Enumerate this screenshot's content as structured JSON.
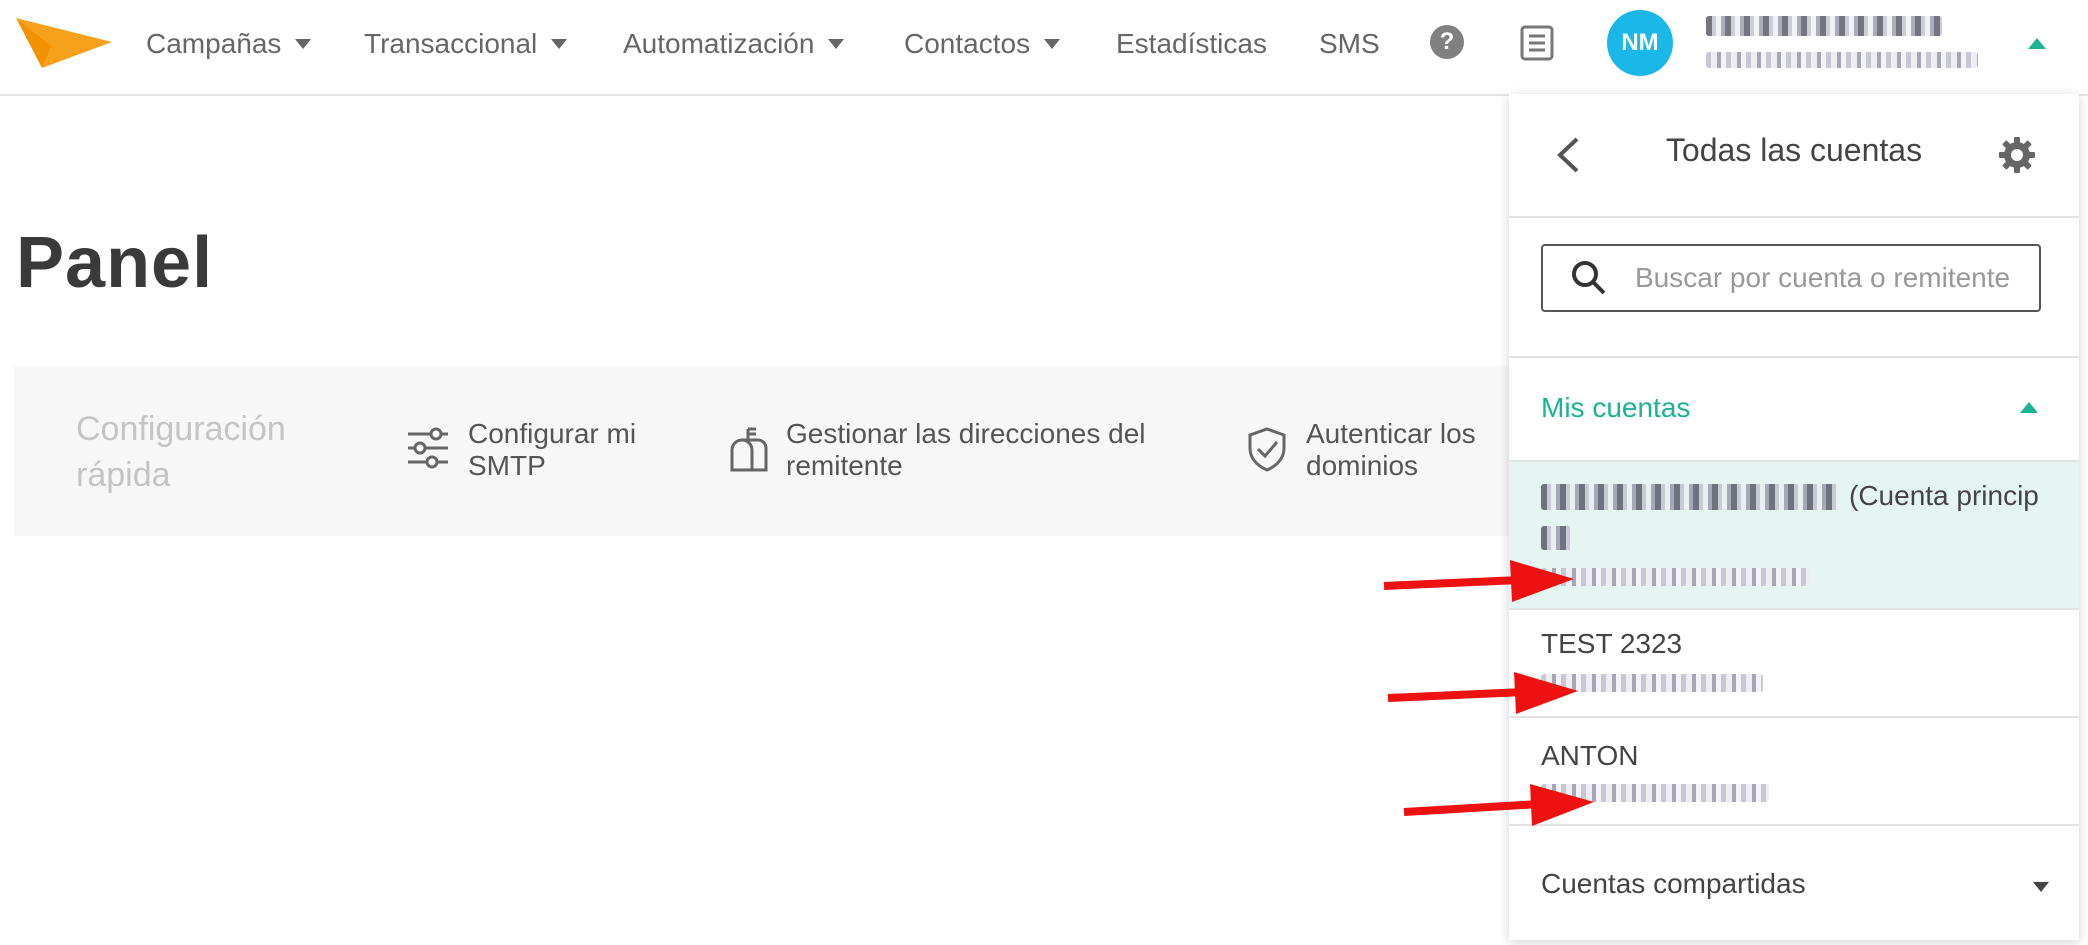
{
  "nav": {
    "items": [
      {
        "label": "Campañas",
        "has_dropdown": true
      },
      {
        "label": "Transaccional",
        "has_dropdown": true
      },
      {
        "label": "Automatización",
        "has_dropdown": true
      },
      {
        "label": "Contactos",
        "has_dropdown": true
      },
      {
        "label": "Estadísticas",
        "has_dropdown": false
      },
      {
        "label": "SMS",
        "has_dropdown": false
      }
    ],
    "help_icon": "?",
    "avatar_initials": "NM",
    "logo_color": "#f7a11a",
    "avatar_color": "#19b8e8",
    "accent_color": "#1ab394"
  },
  "page": {
    "title": "Panel"
  },
  "quick_setup": {
    "title": "Configuración rápida",
    "items": [
      {
        "label": "Configurar mi SMTP",
        "icon": "sliders-icon"
      },
      {
        "label": "Gestionar las direcciones del remitente",
        "icon": "mailbox-icon"
      },
      {
        "label": "Autenticar los dominios",
        "icon": "shield-check-icon"
      }
    ]
  },
  "accounts_panel": {
    "title": "Todas las cuentas",
    "search_placeholder": "Buscar por cuenta o remitente",
    "my_accounts_label": "Mis cuentas",
    "accounts": [
      {
        "name_suffix": "(Cuenta princip",
        "active": true
      },
      {
        "name": "TEST 2323",
        "active": false
      },
      {
        "name": "ANTON",
        "active": false
      }
    ],
    "shared_accounts_label": "Cuentas compartidas"
  }
}
